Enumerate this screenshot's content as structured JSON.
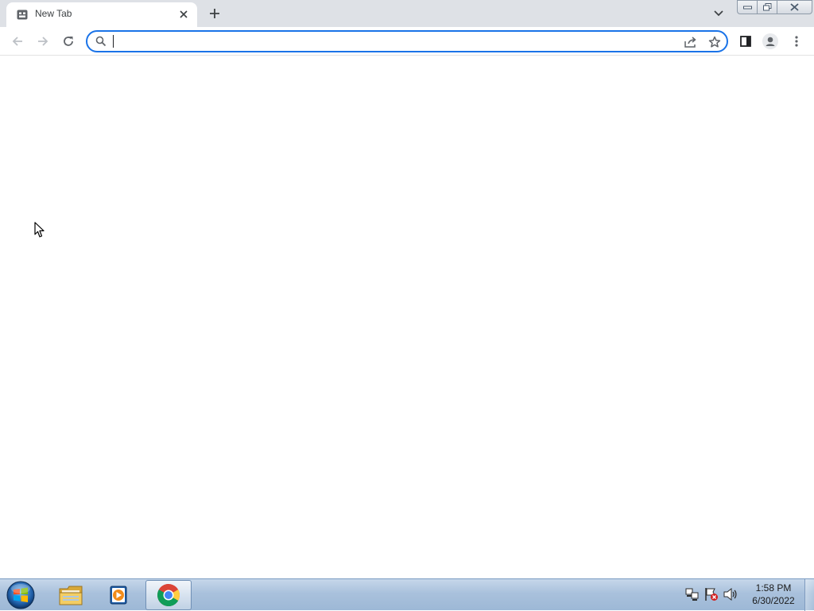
{
  "browser": {
    "tab": {
      "title": "New Tab",
      "favicon": "new-tab-favicon-icon"
    },
    "window_controls": [
      "minimize-icon",
      "restore-icon",
      "close-icon"
    ],
    "toolbar": {
      "omnibox_value": "",
      "icons": [
        "back-arrow-icon",
        "forward-arrow-icon",
        "reload-icon",
        "search-icon",
        "share-icon",
        "star-icon",
        "side-panel-icon",
        "profile-icon",
        "more-menu-icon"
      ]
    },
    "accent_color": "#1a73e8"
  },
  "taskbar": {
    "items": [
      {
        "name": "windows-explorer",
        "icon": "folder-icon",
        "active": false
      },
      {
        "name": "windows-media-player",
        "icon": "media-player-icon",
        "active": false
      },
      {
        "name": "google-chrome",
        "icon": "chrome-icon",
        "active": true
      }
    ],
    "tray_icons": [
      "network-icon",
      "action-center-flag-icon",
      "volume-icon"
    ],
    "clock": {
      "time": "1:58 PM",
      "date": "6/30/2022"
    }
  }
}
